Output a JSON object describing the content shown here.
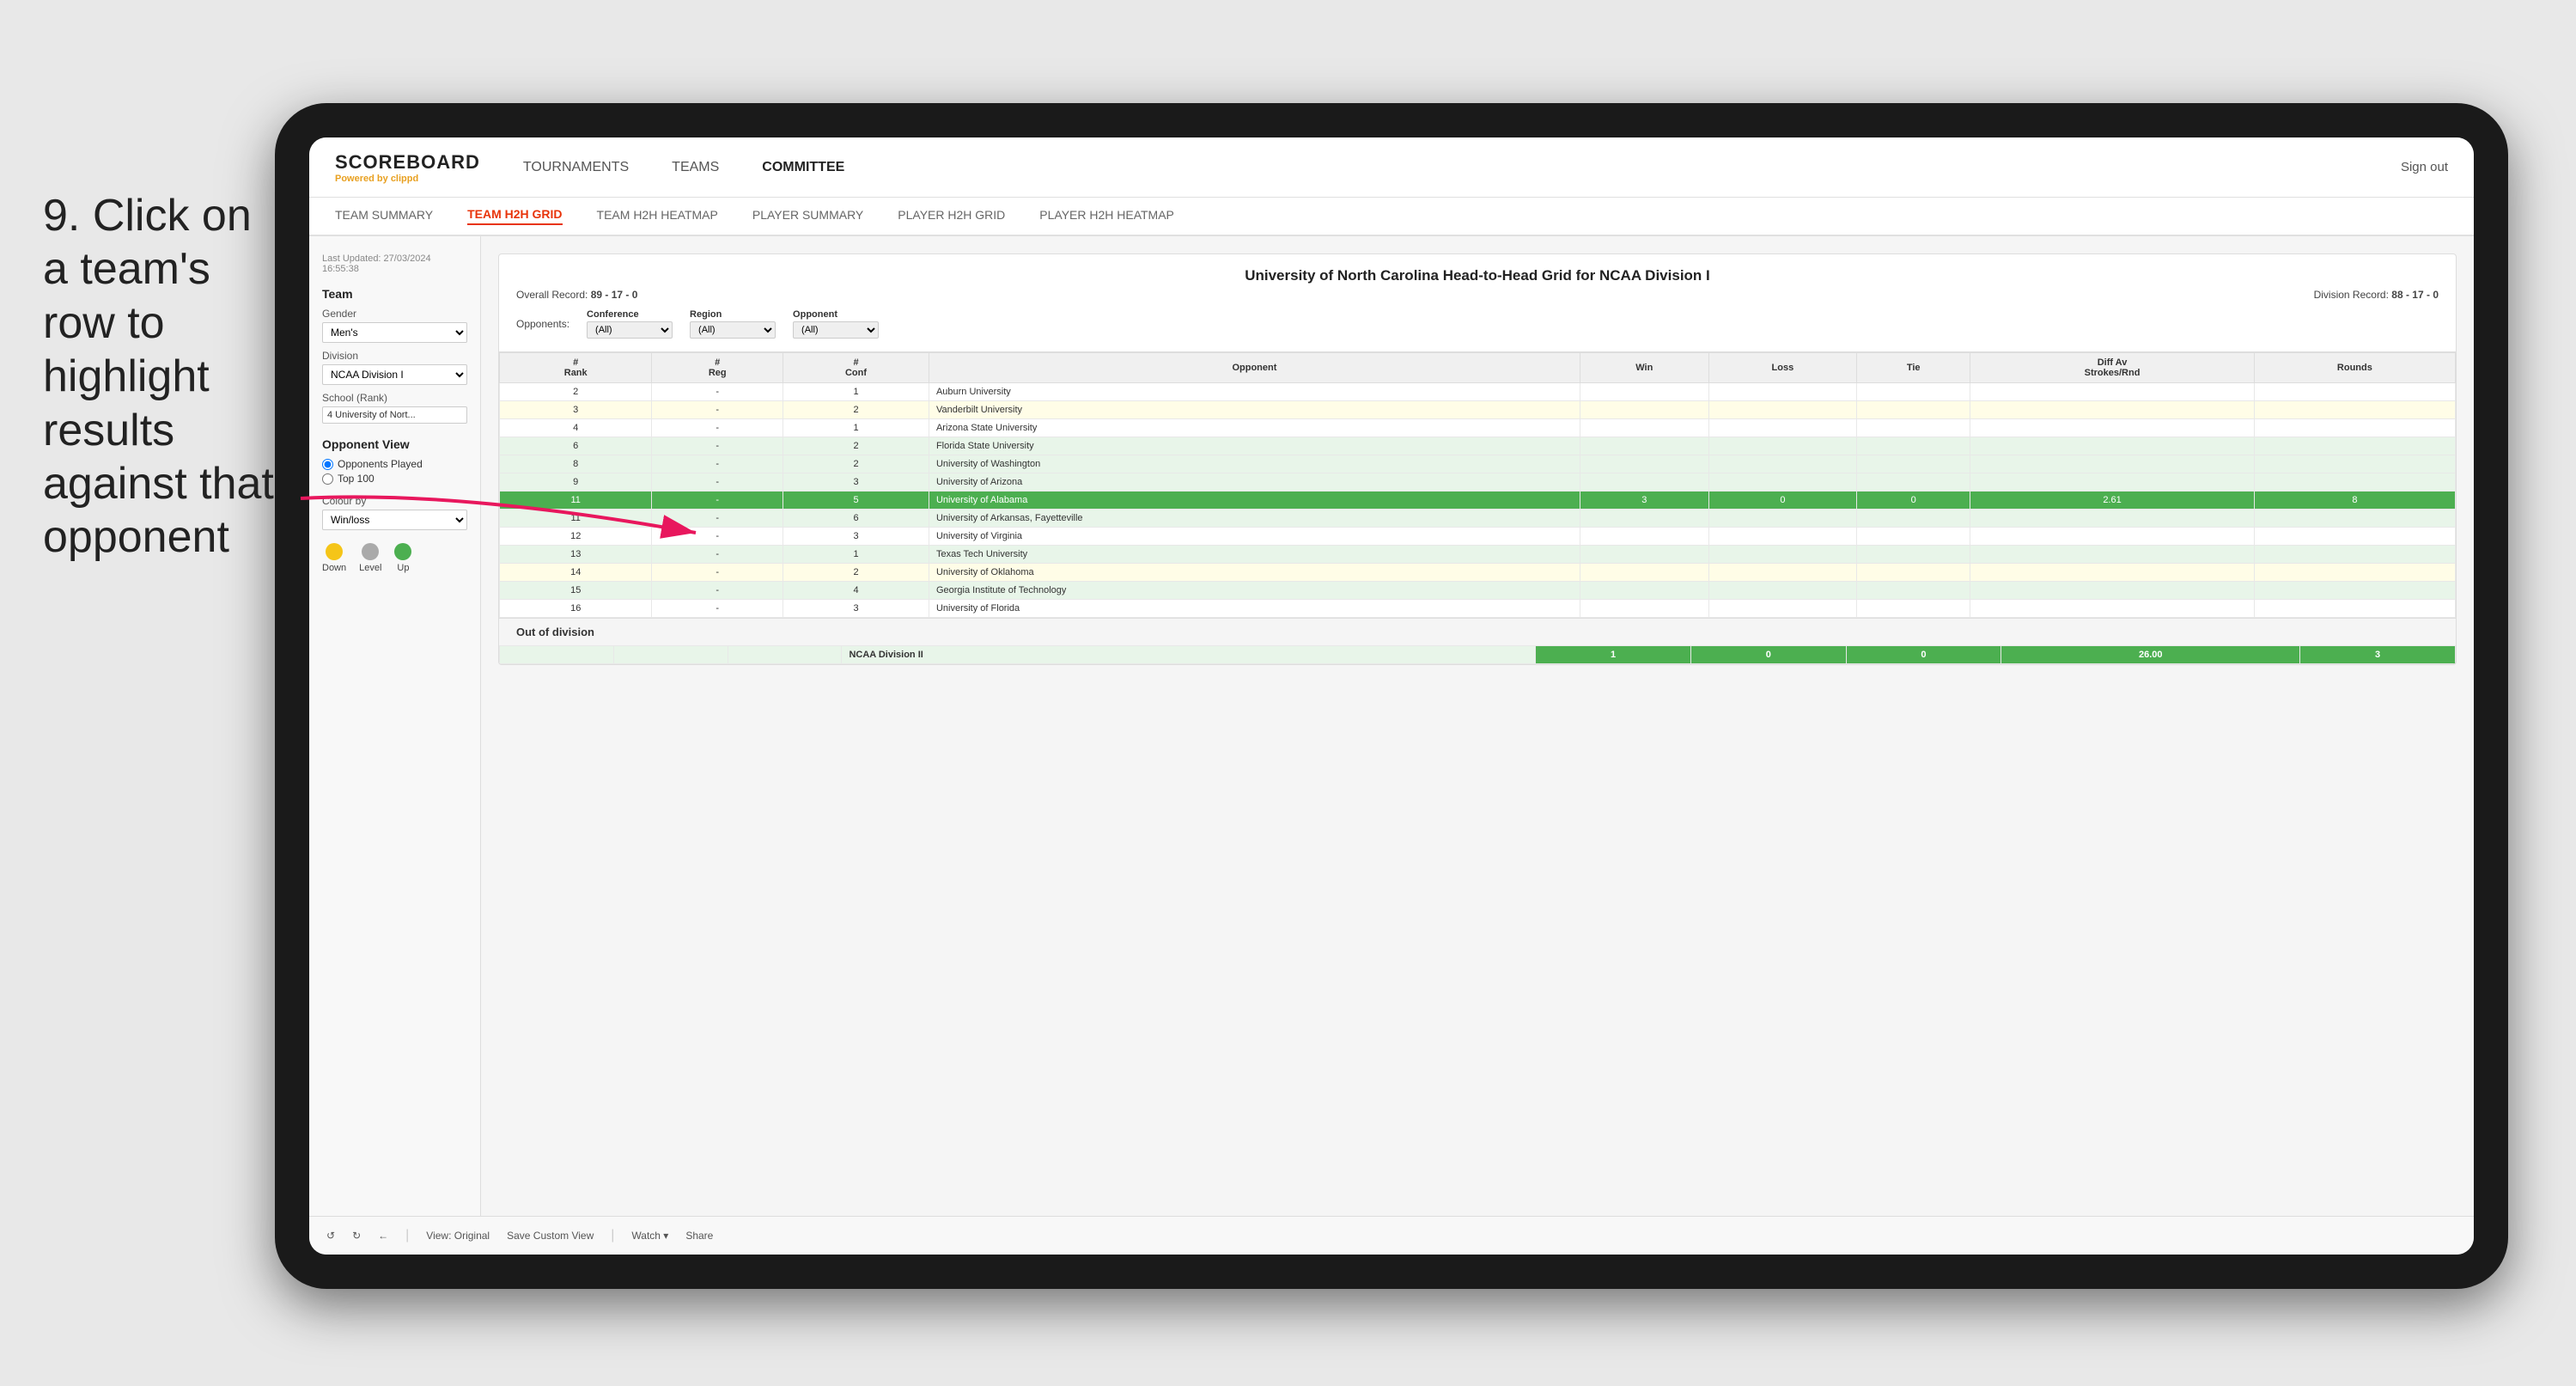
{
  "instruction": {
    "step": "9.",
    "text": "Click on a team's row to highlight results against that opponent"
  },
  "nav": {
    "logo": "SCOREBOARD",
    "logo_sub": "Powered by",
    "logo_brand": "clippd",
    "links": [
      "TOURNAMENTS",
      "TEAMS",
      "COMMITTEE"
    ],
    "sign_in": "Sign out"
  },
  "sub_tabs": [
    {
      "label": "TEAM SUMMARY",
      "active": false
    },
    {
      "label": "TEAM H2H GRID",
      "active": true
    },
    {
      "label": "TEAM H2H HEATMAP",
      "active": false
    },
    {
      "label": "PLAYER SUMMARY",
      "active": false
    },
    {
      "label": "PLAYER H2H GRID",
      "active": false
    },
    {
      "label": "PLAYER H2H HEATMAP",
      "active": false
    }
  ],
  "sidebar": {
    "timestamp_label": "Last Updated: 27/03/2024",
    "timestamp_time": "16:55:38",
    "team_label": "Team",
    "gender_label": "Gender",
    "gender_value": "Men's",
    "division_label": "Division",
    "division_value": "NCAA Division I",
    "school_label": "School (Rank)",
    "school_value": "4 University of Nort...",
    "opponent_view_label": "Opponent View",
    "radio1": "Opponents Played",
    "radio2": "Top 100",
    "colour_by_label": "Colour by",
    "colour_by_value": "Win/loss",
    "legend": {
      "down_label": "Down",
      "level_label": "Level",
      "up_label": "Up"
    }
  },
  "report": {
    "title": "University of North Carolina Head-to-Head Grid for NCAA Division I",
    "overall_record_label": "Overall Record:",
    "overall_record": "89 - 17 - 0",
    "division_record_label": "Division Record:",
    "division_record": "88 - 17 - 0",
    "filters": {
      "conference_label": "Conference",
      "conference_value": "(All)",
      "region_label": "Region",
      "region_value": "(All)",
      "opponent_label": "Opponent",
      "opponent_value": "(All)",
      "opponents_label": "Opponents:"
    },
    "table_headers": [
      "#\nRank",
      "# Reg",
      "# Conf",
      "Opponent",
      "Win",
      "Loss",
      "Tie",
      "Diff Av\nStrokes/Rnd",
      "Rounds"
    ],
    "rows": [
      {
        "rank": "2",
        "reg": "-",
        "conf": "1",
        "opponent": "Auburn University",
        "win": "",
        "loss": "",
        "tie": "",
        "diff": "",
        "rounds": "",
        "style": "normal"
      },
      {
        "rank": "3",
        "reg": "-",
        "conf": "2",
        "opponent": "Vanderbilt University",
        "win": "",
        "loss": "",
        "tie": "",
        "diff": "",
        "rounds": "",
        "style": "light-yellow"
      },
      {
        "rank": "4",
        "reg": "-",
        "conf": "1",
        "opponent": "Arizona State University",
        "win": "",
        "loss": "",
        "tie": "",
        "diff": "",
        "rounds": "",
        "style": "normal"
      },
      {
        "rank": "6",
        "reg": "-",
        "conf": "2",
        "opponent": "Florida State University",
        "win": "",
        "loss": "",
        "tie": "",
        "diff": "",
        "rounds": "",
        "style": "light-green"
      },
      {
        "rank": "8",
        "reg": "-",
        "conf": "2",
        "opponent": "University of Washington",
        "win": "",
        "loss": "",
        "tie": "",
        "diff": "",
        "rounds": "",
        "style": "light-green"
      },
      {
        "rank": "9",
        "reg": "-",
        "conf": "3",
        "opponent": "University of Arizona",
        "win": "",
        "loss": "",
        "tie": "",
        "diff": "",
        "rounds": "",
        "style": "light-green"
      },
      {
        "rank": "11",
        "reg": "-",
        "conf": "5",
        "opponent": "University of Alabama",
        "win": "3",
        "loss": "0",
        "tie": "0",
        "diff": "2.61",
        "rounds": "8",
        "style": "highlighted"
      },
      {
        "rank": "11",
        "reg": "-",
        "conf": "6",
        "opponent": "University of Arkansas, Fayetteville",
        "win": "",
        "loss": "",
        "tie": "",
        "diff": "",
        "rounds": "",
        "style": "light-green"
      },
      {
        "rank": "12",
        "reg": "-",
        "conf": "3",
        "opponent": "University of Virginia",
        "win": "",
        "loss": "",
        "tie": "",
        "diff": "",
        "rounds": "",
        "style": "normal"
      },
      {
        "rank": "13",
        "reg": "-",
        "conf": "1",
        "opponent": "Texas Tech University",
        "win": "",
        "loss": "",
        "tie": "",
        "diff": "",
        "rounds": "",
        "style": "light-green"
      },
      {
        "rank": "14",
        "reg": "-",
        "conf": "2",
        "opponent": "University of Oklahoma",
        "win": "",
        "loss": "",
        "tie": "",
        "diff": "",
        "rounds": "",
        "style": "light-yellow"
      },
      {
        "rank": "15",
        "reg": "-",
        "conf": "4",
        "opponent": "Georgia Institute of Technology",
        "win": "",
        "loss": "",
        "tie": "",
        "diff": "",
        "rounds": "",
        "style": "light-green"
      },
      {
        "rank": "16",
        "reg": "-",
        "conf": "3",
        "opponent": "University of Florida",
        "win": "",
        "loss": "",
        "tie": "",
        "diff": "",
        "rounds": "",
        "style": "normal"
      }
    ],
    "out_of_division_label": "Out of division",
    "out_division_row": {
      "label": "NCAA Division II",
      "win": "1",
      "loss": "0",
      "tie": "0",
      "diff": "26.00",
      "rounds": "3"
    }
  },
  "toolbar": {
    "undo_label": "↩",
    "redo_label": "↪",
    "back_label": "⟵",
    "view_label": "View: Original",
    "save_label": "Save Custom View",
    "watch_label": "Watch ▾",
    "share_label": "Share"
  }
}
